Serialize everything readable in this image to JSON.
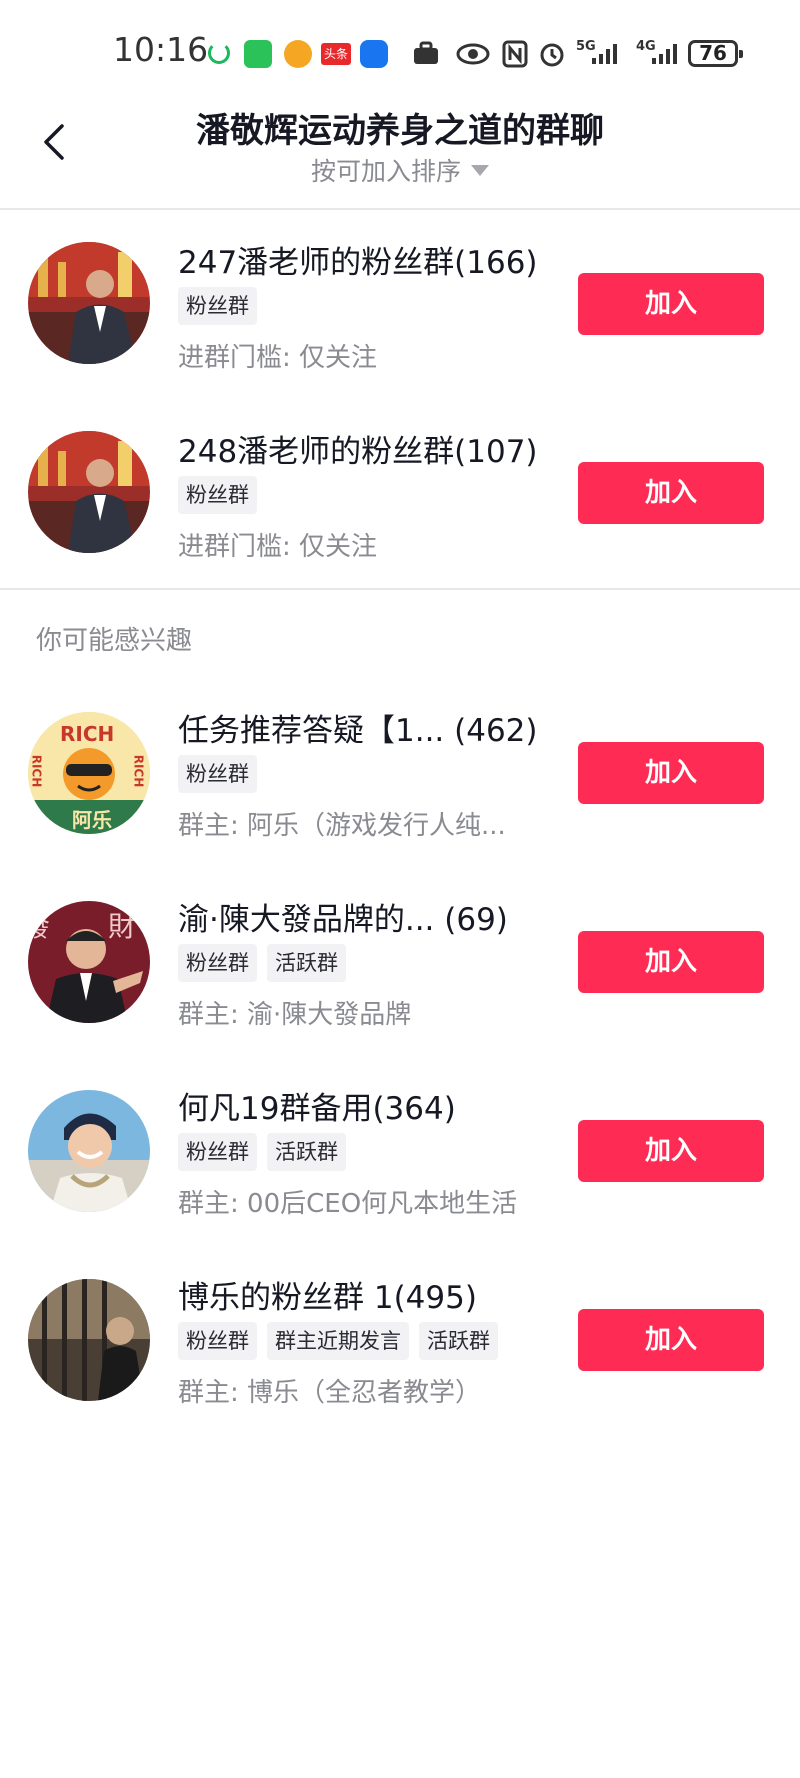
{
  "status_bar": {
    "time": "10:16",
    "toutiao": "头条",
    "network_5g": "5G",
    "network_4g": "4G",
    "battery": "76"
  },
  "header": {
    "title": "潘敬辉运动养身之道的群聊",
    "sort_label": "按可加入排序"
  },
  "groups": [
    {
      "name": "247潘老师的粉丝群(166)",
      "tags": [
        "粉丝群"
      ],
      "sub": "进群门槛: 仅关注",
      "button": "加入"
    },
    {
      "name": "248潘老师的粉丝群(107)",
      "tags": [
        "粉丝群"
      ],
      "sub": "进群门槛: 仅关注",
      "button": "加入"
    }
  ],
  "suggested": {
    "section_label": "你可能感兴趣",
    "items": [
      {
        "name": "任务推荐答疑【1... (462)",
        "tags": [
          "粉丝群"
        ],
        "sub": "群主: 阿乐（游戏发行人纯...",
        "button": "加入",
        "avatar_text": [
          "RICH",
          "RICH",
          "RICH",
          "阿乐"
        ]
      },
      {
        "name": "渝·陳大發品牌的...  (69)",
        "tags": [
          "粉丝群",
          "活跃群"
        ],
        "sub": "群主: 渝·陳大發品牌",
        "button": "加入",
        "avatar_text": [
          "發",
          "財"
        ]
      },
      {
        "name": "何凡19群备用(364)",
        "tags": [
          "粉丝群",
          "活跃群"
        ],
        "sub": "群主: 00后CEO何凡本地生活",
        "button": "加入"
      },
      {
        "name": "博乐的粉丝群 1(495)",
        "tags": [
          "粉丝群",
          "群主近期发言",
          "活跃群"
        ],
        "sub": "群主: 博乐（全忍者教学）",
        "button": "加入"
      }
    ]
  },
  "colors": {
    "join_button": "#fe2c55",
    "tag_bg": "#f2f2f4",
    "secondary_text": "#8a8b91"
  }
}
